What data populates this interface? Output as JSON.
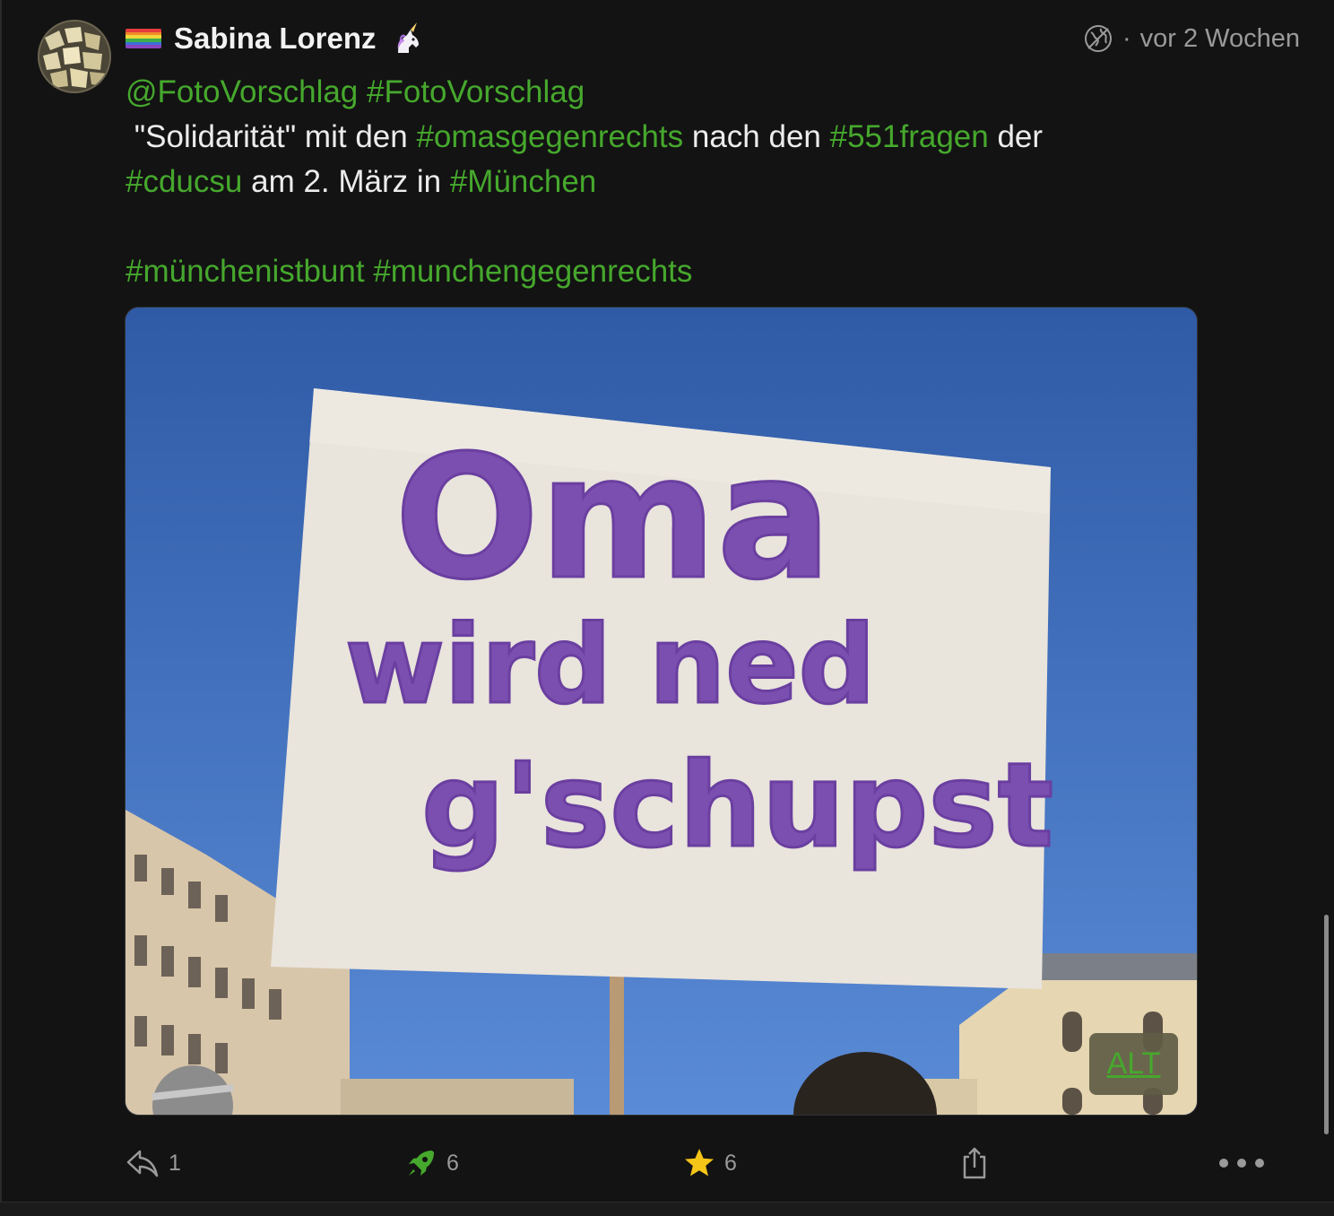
{
  "post": {
    "author_name": "Sabina Lorenz",
    "timestamp": "vor 2 Wochen",
    "separator": "·",
    "content": {
      "line1_mention": "@FotoVorschlag",
      "line1_tag": "#FotoVorschlag",
      "line2_part1": " \"Solidarität\" mit den ",
      "line2_tag1": "#omasgegenrechts",
      "line2_part2": " nach den ",
      "line2_tag2": "#551fragen",
      "line2_part3": " der",
      "line3_tag1": "#cducsu",
      "line3_part1": " am 2. März in ",
      "line3_tag2": "#München",
      "line4_tag1": "#münchenistbunt",
      "line4_tag2": "#munchengegenrechts"
    },
    "image": {
      "sign_text_line1": "Oma",
      "sign_text_line2": "wird ned",
      "sign_text_line3": "g'schupst",
      "alt_badge": "ALT"
    },
    "actions": {
      "reply_count": "1",
      "boost_count": "6",
      "favourite_count": "6"
    }
  },
  "icons": {
    "reply": "reply-icon",
    "boost": "rocket-icon",
    "favourite": "star-icon",
    "share": "share-icon",
    "more": "more-icon",
    "visibility": "globe-icon",
    "author_badge": "unicorn-icon",
    "pride_flag": "rainbow-flag-icon"
  },
  "colors": {
    "background": "#131313",
    "hashtag": "#46a82d",
    "muted": "#9a9a9a",
    "star": "#f5c518",
    "boost": "#46a82d"
  }
}
